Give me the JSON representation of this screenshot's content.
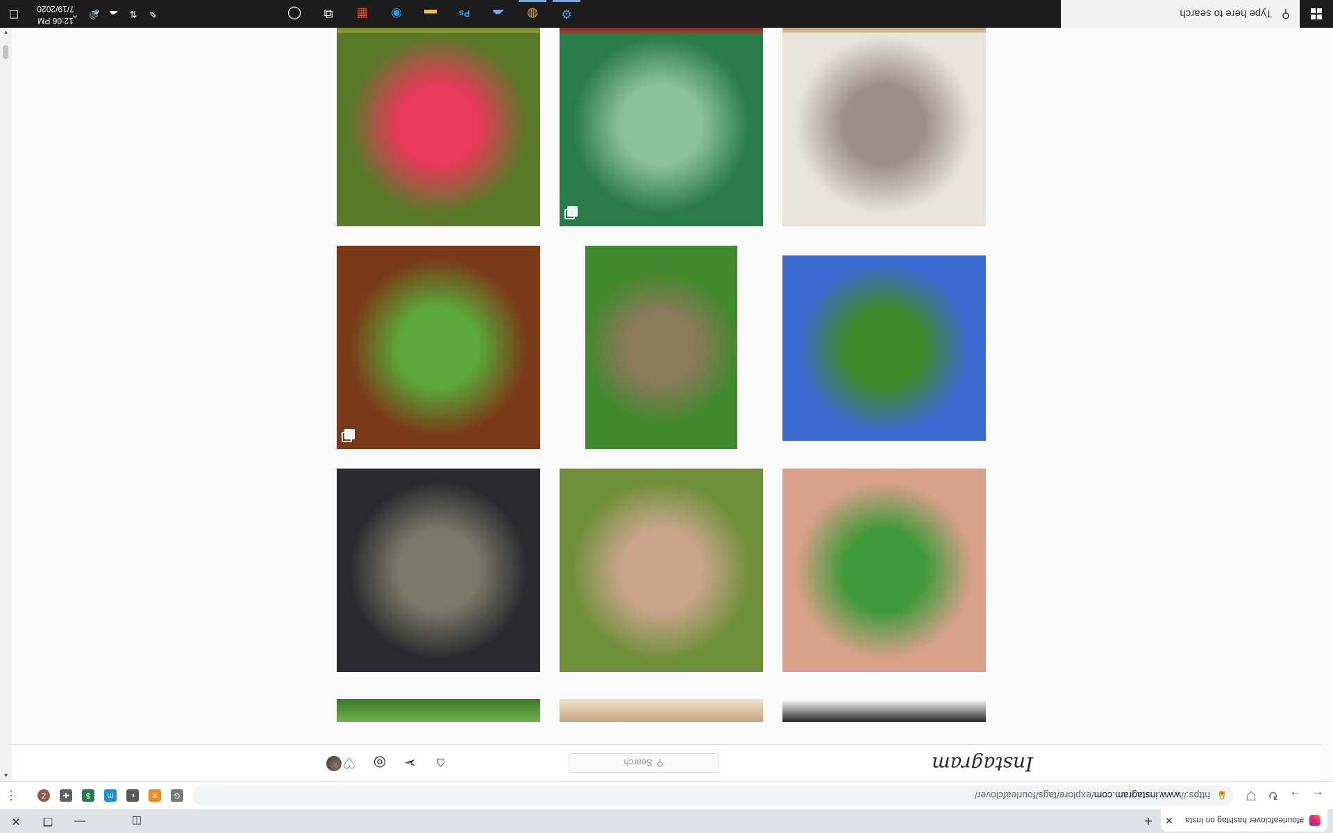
{
  "browser": {
    "tab_title": "#fourleafclover hashtag on Insta",
    "new_tab": "+",
    "url_scheme": "https://",
    "url_host": "www.instagram.com",
    "url_path": "/explore/tags/fourleafclover/",
    "window_controls": [
      "—",
      "❐",
      "✕"
    ],
    "extensions": [
      {
        "name": "G",
        "color": "#7a7a7a"
      },
      {
        "name": "✕",
        "color": "#f08a24"
      },
      {
        "name": "◐",
        "color": "#5a5a5a"
      },
      {
        "name": "m",
        "color": "#1a8fe0"
      },
      {
        "name": "$",
        "color": "#2a7a4a"
      },
      {
        "name": "✚",
        "color": "#5f6368"
      },
      {
        "name": "Z",
        "color": "#8a5a4a"
      }
    ]
  },
  "instagram": {
    "logo": "Instagram",
    "search_placeholder": "Search",
    "search_icon": "⚲",
    "nav_icons": [
      "home-icon",
      "direct-icon",
      "explore-icon",
      "activity-icon",
      "profile-avatar"
    ]
  },
  "grid": {
    "rows": [
      [
        {
          "alt": "four-leaf clover held in palm",
          "colors": [
            "#d9a08a",
            "#3e9a3a"
          ],
          "multi": false
        },
        {
          "alt": "clover held over grass with dog",
          "colors": [
            "#6f8f3a",
            "#c9a48a"
          ],
          "multi": false
        },
        {
          "alt": "clover held above black helmet",
          "colors": [
            "#2a2a2e",
            "#7a7a6a"
          ],
          "multi": false
        }
      ],
      [
        {
          "alt": "clover on notebook paper",
          "colors": [
            "#3a6bd0",
            "#3d8a2a"
          ],
          "multi": false
        },
        {
          "alt": "close-up green leaf",
          "colors": [
            "#3f8a2c",
            "#8a7a5a"
          ],
          "multi": false
        },
        {
          "alt": "clover resin dome on wood",
          "colors": [
            "#7a3a18",
            "#5aa83a"
          ],
          "multi": true
        }
      ],
      [
        {
          "alt": "clover resin ring on hand",
          "colors": [
            "#e8e4dc",
            "#9c8f86"
          ],
          "multi": false
        },
        {
          "alt": "patch of clover with flowers",
          "colors": [
            "#2a7a4a",
            "#8ac09a"
          ],
          "multi": true
        },
        {
          "alt": "four-leaf clover held by pink nails",
          "colors": [
            "#5a7a2a",
            "#e83a5a"
          ],
          "multi": false
        }
      ]
    ]
  },
  "taskbar": {
    "search_placeholder": "Type here to search",
    "search_icon": "⚲",
    "apps": [
      {
        "name": "cortana-icon",
        "glyph": "◯"
      },
      {
        "name": "task-view-icon",
        "glyph": "⧉"
      },
      {
        "name": "store-icon",
        "glyph": "▦",
        "color": "#e04a2a"
      },
      {
        "name": "edge-icon",
        "glyph": "◉",
        "color": "#2a9ae0"
      },
      {
        "name": "file-explorer-icon",
        "glyph": "▬",
        "color": "#f0c040"
      },
      {
        "name": "photoshop-icon",
        "glyph": "Ps",
        "color": "#31a8ff"
      },
      {
        "name": "onedrive-icon",
        "glyph": "☁",
        "color": "#6ab0f0"
      },
      {
        "name": "chrome-icon",
        "glyph": "◍",
        "color": "#e8b030",
        "active": true
      },
      {
        "name": "app-gear-icon",
        "glyph": "⚙",
        "color": "#4a9ae0",
        "active": true
      }
    ],
    "tray": [
      "⌃",
      "🔊",
      "☁",
      "⇅",
      "✎"
    ],
    "time": "12:06 PM",
    "date": "7/19/2020"
  }
}
